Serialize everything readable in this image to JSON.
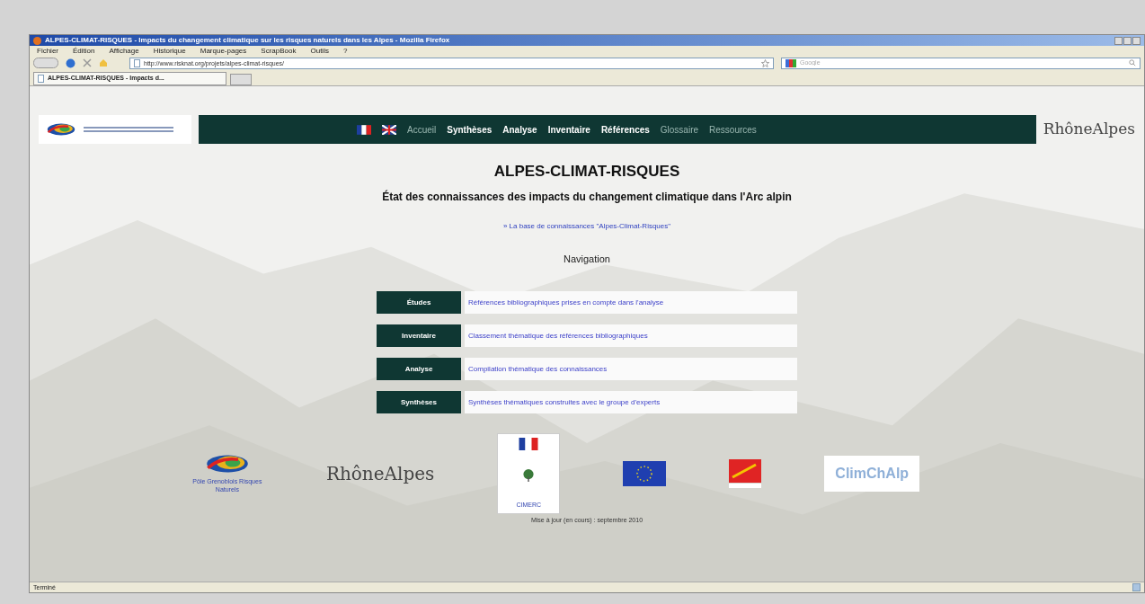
{
  "window": {
    "title": "ALPES-CLIMAT-RISQUES - Impacts du changement climatique sur les risques naturels dans les Alpes - Mozilla Firefox"
  },
  "menu": [
    "Fichier",
    "Édition",
    "Affichage",
    "Historique",
    "Marque-pages",
    "ScrapBook",
    "Outils",
    "?"
  ],
  "address_bar": {
    "value": "http://www.risknat.org/projets/alpes-climat-risques/"
  },
  "search": {
    "placeholder": "Google"
  },
  "tabs": [
    {
      "label": "ALPES-CLIMAT-RISQUES - Impacts d...",
      "selected": true
    }
  ],
  "site_nav": [
    {
      "label": "Accueil",
      "strong": false
    },
    {
      "label": "Synthèses",
      "strong": true
    },
    {
      "label": "Analyse",
      "strong": true
    },
    {
      "label": "Inventaire",
      "strong": true
    },
    {
      "label": "Références",
      "strong": true
    },
    {
      "label": "Glossaire",
      "strong": false
    },
    {
      "label": "Ressources",
      "strong": false
    }
  ],
  "header_logo_text": "RhôneAlpes",
  "page": {
    "title": "ALPES-CLIMAT-RISQUES",
    "subtitle": "État des connaissances des impacts du changement climatique dans l'Arc alpin",
    "knowledge_link": "» La base de connaissances \"Alpes-Climat-Risques\"",
    "nav_heading": "Navigation"
  },
  "sections": [
    {
      "button": "Études",
      "description": "Références bibliographiques prises en compte dans l'analyse"
    },
    {
      "button": "Inventaire",
      "description": "Classement thématique des références bibliographiques"
    },
    {
      "button": "Analyse",
      "description": "Compilation thématique des connaissances"
    },
    {
      "button": "Synthèses",
      "description": "Synthèses thématiques construites avec le groupe d'experts"
    }
  ],
  "partners": [
    {
      "kind": "pgrn",
      "label": "Pôle Grenoblois Risques Naturels"
    },
    {
      "kind": "wordmark",
      "label": "RhôneAlpes"
    },
    {
      "kind": "ministry",
      "label": "CIMERC"
    },
    {
      "kind": "eu"
    },
    {
      "kind": "region"
    },
    {
      "kind": "climchalp",
      "label": "ClimChAlp"
    }
  ],
  "footer": "Mise à jour (en cours) : septembre 2010",
  "status_bar": "Terminé"
}
